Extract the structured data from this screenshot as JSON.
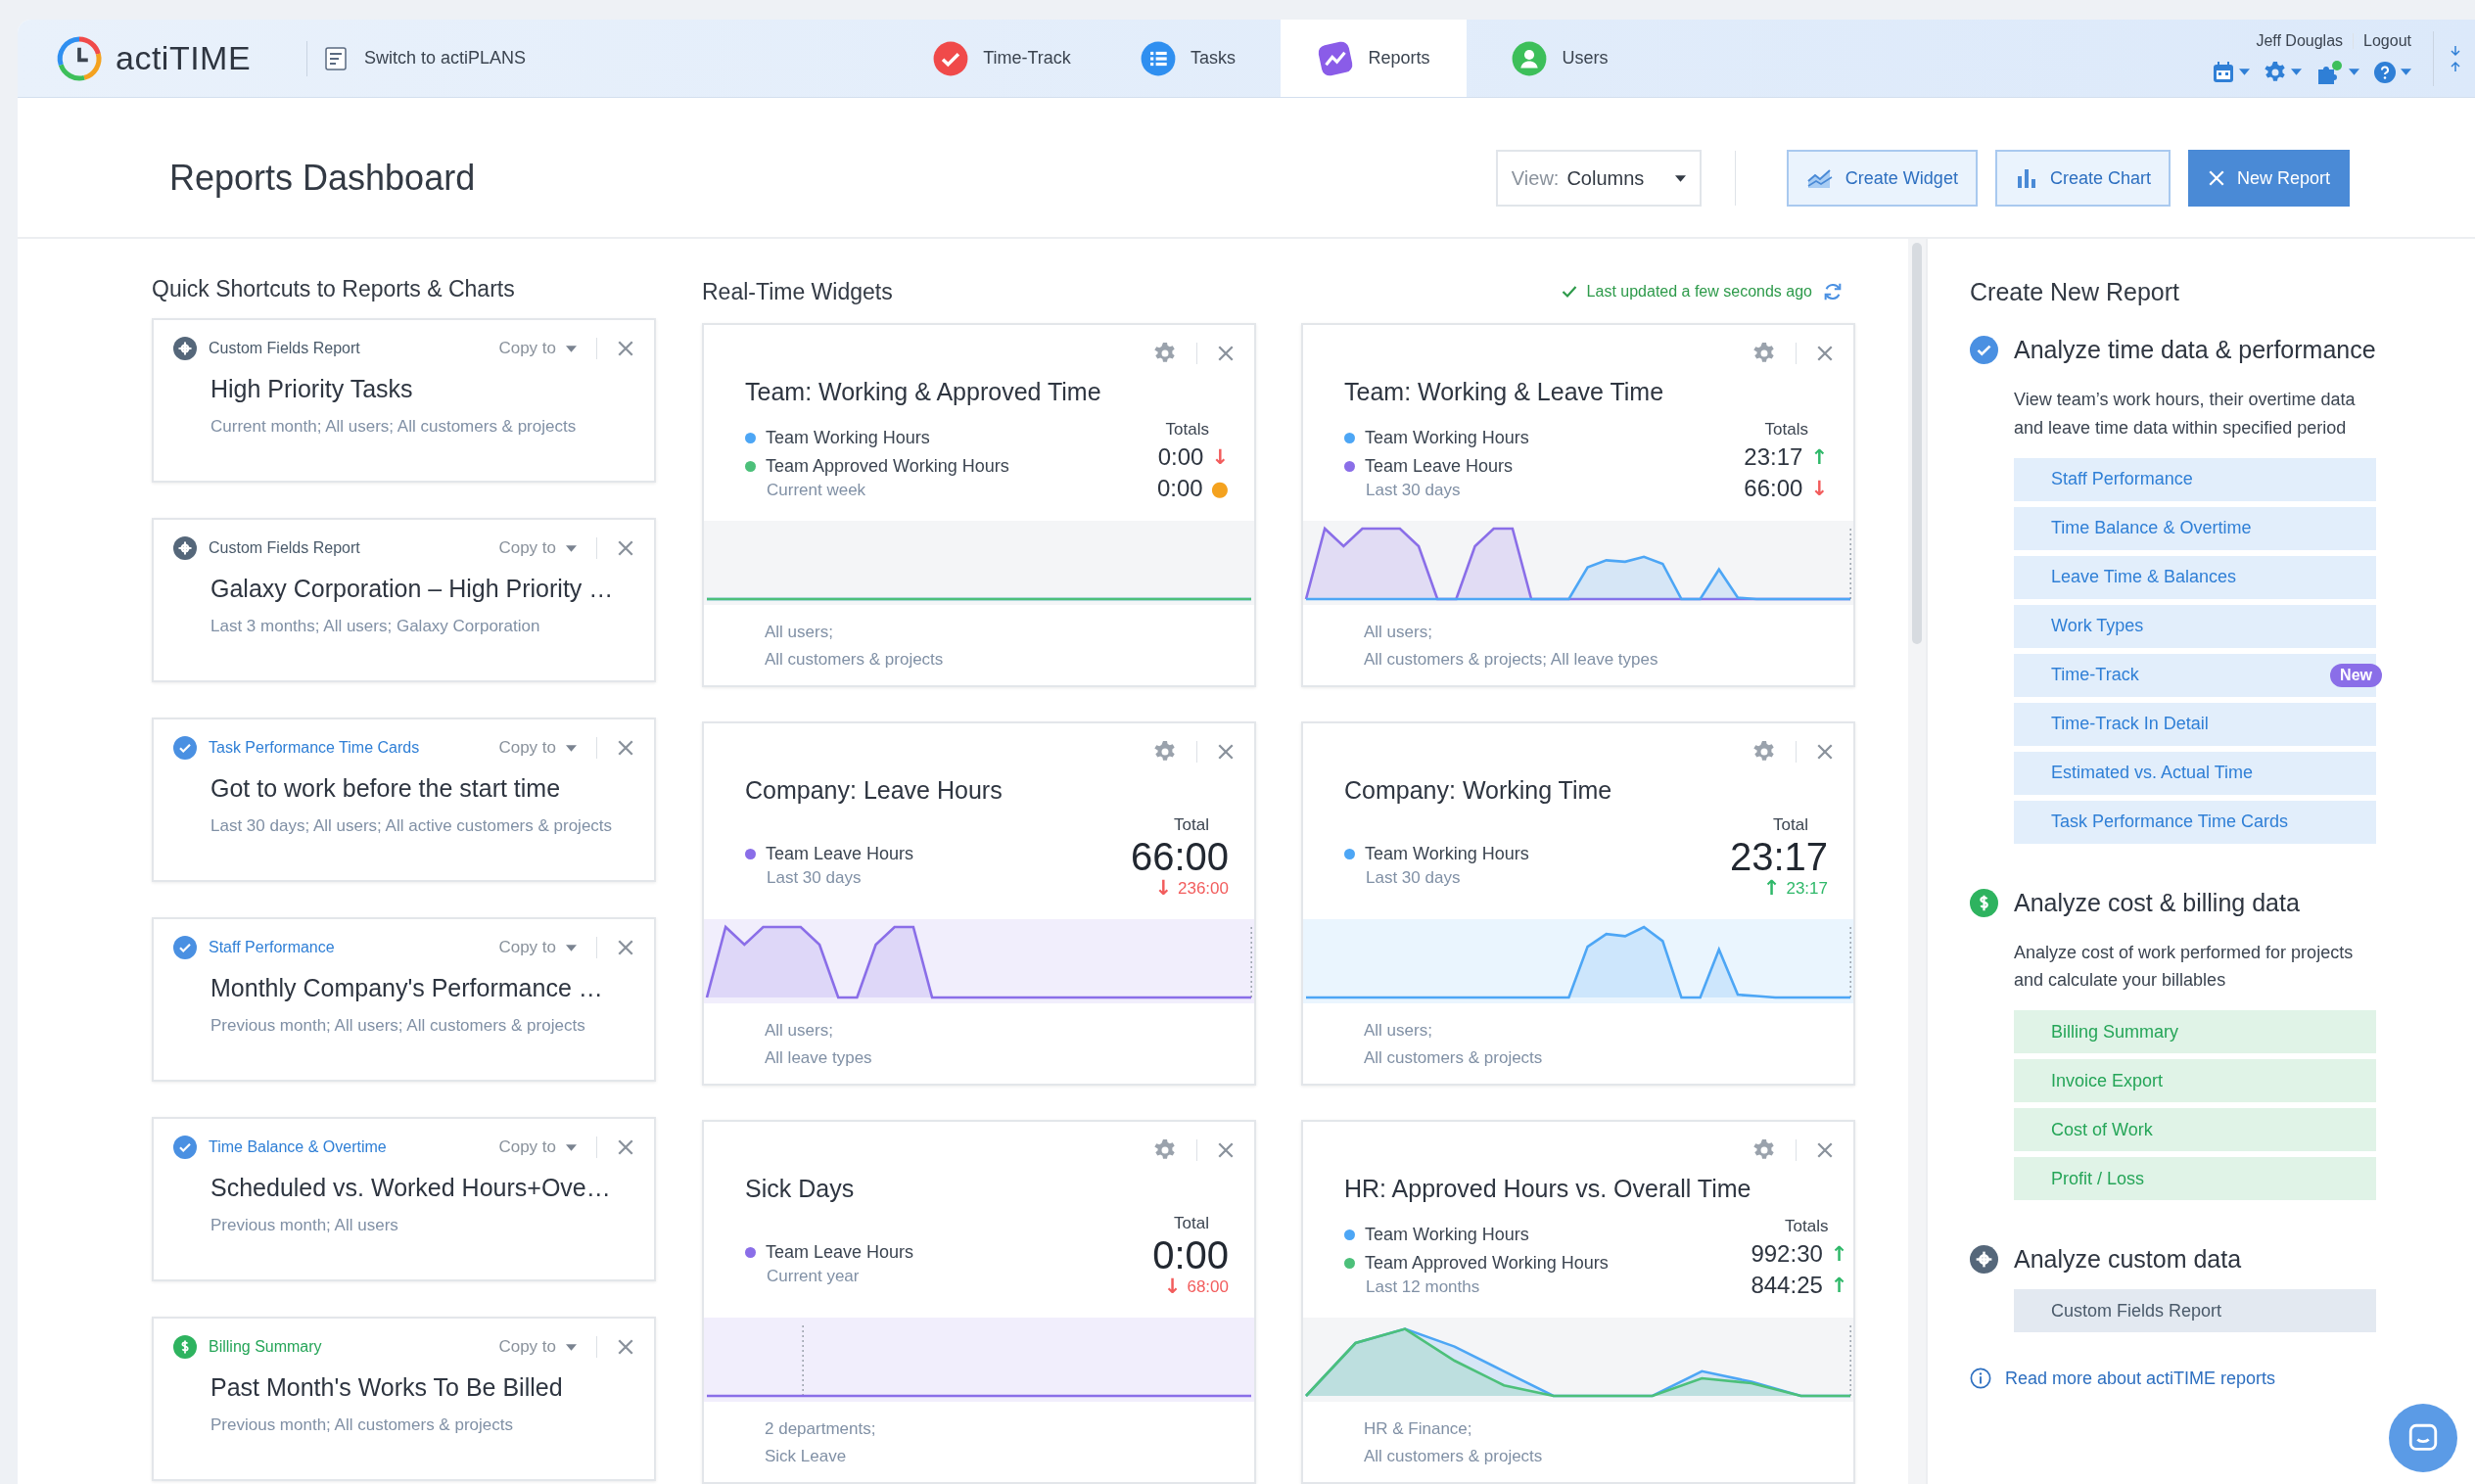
{
  "header": {
    "logo": "actiTIME",
    "switch_link": "Switch to actiPLANS",
    "tabs": [
      {
        "label": "Time-Track",
        "kind": "timetrack",
        "selected": false
      },
      {
        "label": "Tasks",
        "kind": "tasks",
        "selected": false
      },
      {
        "label": "Reports",
        "kind": "reports",
        "selected": true
      },
      {
        "label": "Users",
        "kind": "users",
        "selected": false
      }
    ],
    "user": "Jeff Douglas",
    "logout": "Logout"
  },
  "page_title": "Reports Dashboard",
  "toolbar": {
    "view_label": "View:",
    "view_value": "Columns",
    "buttons": [
      {
        "label": "Create Widget",
        "kind": "widget"
      },
      {
        "label": "Create Chart",
        "kind": "chart"
      },
      {
        "label": "New Report",
        "kind": "new"
      }
    ]
  },
  "shortcuts": {
    "heading": "Quick Shortcuts to Reports & Charts",
    "cards": [
      {
        "kind": "custom",
        "category": "Custom Fields Report",
        "copy": "Copy to",
        "title": "High Priority Tasks",
        "description": "Current month; All users; All customers & projects"
      },
      {
        "kind": "custom",
        "category": "Custom Fields Report",
        "copy": "Copy to",
        "title": "Galaxy Corporation – High Priority …",
        "description": "Last 3 months; All users; Galaxy Corporation"
      },
      {
        "kind": "time",
        "category": "Task Performance Time Cards",
        "copy": "Copy to",
        "title": "Got to work before the start time",
        "description": "Last 30 days; All users; All active customers & projects"
      },
      {
        "kind": "time",
        "category": "Staff Performance",
        "copy": "Copy to",
        "title": "Monthly Company's Performance …",
        "description": "Previous month; All users; All customers & projects"
      },
      {
        "kind": "time",
        "category": "Time Balance & Overtime",
        "copy": "Copy to",
        "title": "Scheduled vs. Worked Hours+Ove…",
        "description": "Previous month; All users"
      },
      {
        "kind": "billing",
        "category": "Billing Summary",
        "copy": "Copy to",
        "title": "Past Month's Works To Be Billed",
        "description": "Previous month; All customers & projects"
      }
    ]
  },
  "widgets": {
    "heading": "Real-Time Widgets",
    "status": "Last updated a few seconds ago",
    "items": [
      {
        "kind": "totals",
        "title": "Team: Working & Approved Time",
        "totals_label": "Totals",
        "series": [
          {
            "name": "Team Working Hours",
            "color": "#4da6f5",
            "value": "0:00",
            "trend": {
              "arrow": "↓",
              "color": "#f25c5c"
            }
          },
          {
            "name": "Team Approved Working Hours",
            "color": "#4cc07a",
            "value": "0:00",
            "trend": {
              "arrow": "●",
              "color": "#f4a21f"
            }
          }
        ],
        "period": "Current week",
        "filters": [
          "All users;",
          "All customers & projects"
        ]
      },
      {
        "kind": "totals",
        "title": "Team: Working & Leave Time",
        "totals_label": "Totals",
        "series": [
          {
            "name": "Team Working Hours",
            "color": "#4da6f5",
            "value": "23:17",
            "trend": {
              "arrow": "↑",
              "color": "#2fb869"
            }
          },
          {
            "name": "Team Leave Hours",
            "color": "#8a6ee8",
            "value": "66:00",
            "trend": {
              "arrow": "↓",
              "color": "#f25c5c"
            }
          }
        ],
        "period": "Last 30 days",
        "filters": [
          "All users;",
          "All customers & projects; All leave types"
        ]
      },
      {
        "kind": "single",
        "title": "Company: Leave Hours",
        "totals_label": "Total",
        "series": [
          {
            "name": "Team Leave Hours",
            "color": "#8a6ee8"
          }
        ],
        "value": "66:00",
        "delta": "236:00",
        "trend": {
          "arrow": "↓",
          "color": "#f25c5c"
        },
        "period": "Last 30 days",
        "filters": [
          "All users;",
          "All leave types"
        ]
      },
      {
        "kind": "single",
        "title": "Company: Working Time",
        "totals_label": "Total",
        "series": [
          {
            "name": "Team Working Hours",
            "color": "#4da6f5"
          }
        ],
        "value": "23:17",
        "delta": "23:17",
        "trend": {
          "arrow": "↑",
          "color": "#2fb869"
        },
        "period": "Last 30 days",
        "filters": [
          "All users;",
          "All customers & projects"
        ]
      },
      {
        "kind": "single",
        "title": "Sick Days",
        "totals_label": "Total",
        "series": [
          {
            "name": "Team Leave Hours",
            "color": "#8a6ee8"
          }
        ],
        "value": "0:00",
        "delta": "68:00",
        "trend": {
          "arrow": "↓",
          "color": "#f25c5c"
        },
        "period": "Current year",
        "filters": [
          "2 departments;",
          "Sick Leave"
        ]
      },
      {
        "kind": "totals",
        "title": "HR: Approved Hours vs. Overall Time",
        "totals_label": "Totals",
        "series": [
          {
            "name": "Team Working Hours",
            "color": "#4da6f5",
            "value": "992:30",
            "trend": {
              "arrow": "↑",
              "color": "#2fb869"
            }
          },
          {
            "name": "Team Approved Working Hours",
            "color": "#4cc07a",
            "value": "844:25",
            "trend": {
              "arrow": "↑",
              "color": "#2fb869"
            }
          }
        ],
        "period": "Last 12 months",
        "filters": [
          "HR & Finance;",
          "All customers & projects"
        ]
      }
    ]
  },
  "create_panel": {
    "heading": "Create New Report",
    "sections": [
      {
        "kind": "time",
        "title": "Analyze time data & performance",
        "description": "View team’s work hours, their overtime data and leave time data within specified period",
        "items": [
          {
            "label": "Staff Performance"
          },
          {
            "label": "Time Balance & Overtime"
          },
          {
            "label": "Leave Time & Balances"
          },
          {
            "label": "Work Types"
          },
          {
            "label": "Time-Track",
            "badge": "New"
          },
          {
            "label": "Time-Track In Detail"
          },
          {
            "label": "Estimated vs. Actual Time"
          },
          {
            "label": "Task Performance Time Cards"
          }
        ]
      },
      {
        "kind": "billing",
        "title": "Analyze cost & billing data",
        "description": "Analyze cost of work performed for projects and calculate your billables",
        "items": [
          {
            "label": "Billing Summary"
          },
          {
            "label": "Invoice Export"
          },
          {
            "label": "Cost of Work"
          },
          {
            "label": "Profit / Loss"
          }
        ]
      },
      {
        "kind": "custom",
        "title": "Analyze custom data",
        "items": [
          {
            "label": "Custom Fields Report"
          }
        ]
      }
    ],
    "more_link": "Read more about actiTIME reports"
  }
}
